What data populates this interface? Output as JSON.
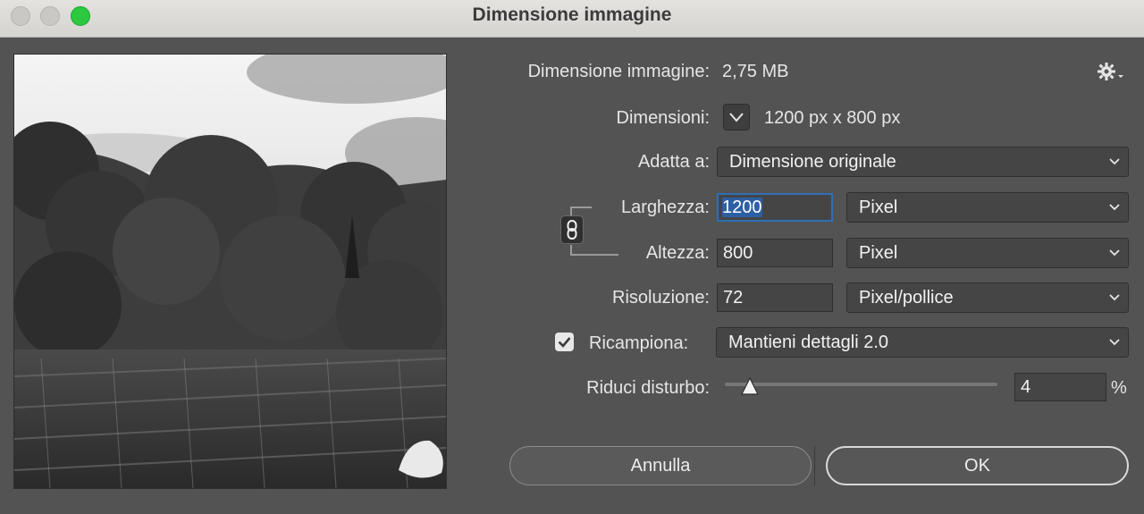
{
  "window": {
    "title": "Dimensione immagine"
  },
  "info": {
    "size_label": "Dimensione immagine:",
    "size_value": "2,75 MB",
    "dimensions_label": "Dimensioni:",
    "dimensions_value": "1200 px x 800 px"
  },
  "fit": {
    "label": "Adatta a:",
    "value": "Dimensione originale"
  },
  "width": {
    "label": "Larghezza:",
    "value": "1200",
    "unit": "Pixel"
  },
  "height": {
    "label": "Altezza:",
    "value": "800",
    "unit": "Pixel"
  },
  "resolution": {
    "label": "Risoluzione:",
    "value": "72",
    "unit": "Pixel/pollice"
  },
  "resample": {
    "label": "Ricampiona:",
    "checked": true,
    "value": "Mantieni dettagli 2.0"
  },
  "noise": {
    "label": "Riduci disturbo:",
    "value": "4",
    "unit": "%",
    "level_percent": 4
  },
  "buttons": {
    "cancel": "Annulla",
    "ok": "OK"
  },
  "icons": {
    "settings": "gear-icon",
    "dimensions_toggle": "chevron-down-icon",
    "constrain": "link-icon",
    "checkbox": "checkmark-icon",
    "close": "close-icon",
    "minimize": "minimize-icon",
    "maximize": "maximize-icon"
  },
  "colors": {
    "dialog_bg": "#535353",
    "field_bg": "#454545",
    "focus": "#2f6fb5",
    "maximize": "#2bc840"
  }
}
